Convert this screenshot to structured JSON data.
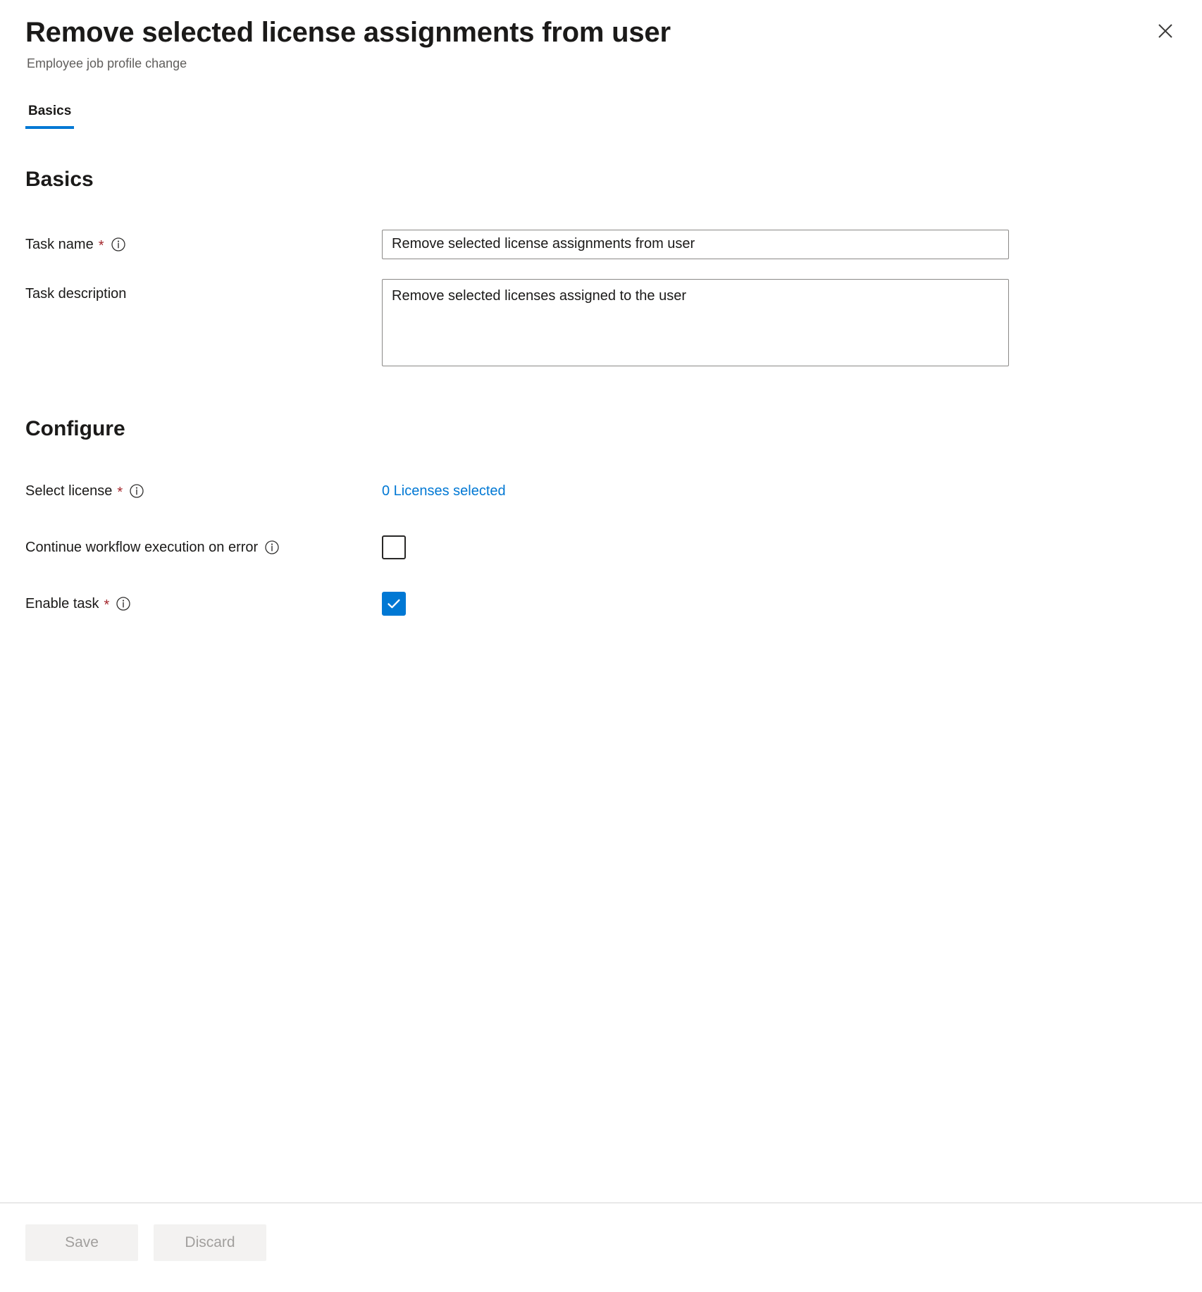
{
  "header": {
    "title": "Remove selected license assignments from user",
    "subtitle": "Employee job profile change",
    "close_label": "Close",
    "close_icon": "close-icon"
  },
  "tabs": [
    {
      "label": "Basics",
      "selected": true
    }
  ],
  "sections": {
    "basics": {
      "heading": "Basics",
      "task_name": {
        "label": "Task name",
        "required_marker": "*",
        "info_icon": "info-icon",
        "value": "Remove selected license assignments from user",
        "placeholder": ""
      },
      "task_description": {
        "label": "Task description",
        "value": "Remove selected licenses assigned to the user",
        "placeholder": ""
      }
    },
    "configure": {
      "heading": "Configure",
      "select_license": {
        "label": "Select license",
        "required_marker": "*",
        "info_icon": "info-icon",
        "link_text": "0 Licenses selected",
        "link_color": "#0078d4"
      },
      "continue_on_error": {
        "label": "Continue workflow execution on error",
        "info_icon": "info-icon",
        "checked": false
      },
      "enable_task": {
        "label": "Enable task",
        "required_marker": "*",
        "info_icon": "info-icon",
        "checked": true
      }
    }
  },
  "footer": {
    "save_label": "Save",
    "discard_label": "Discard"
  },
  "colors": {
    "accent": "#0078d4",
    "required": "#a4262c",
    "text": "#1b1a19",
    "subtle_text": "#605e5c",
    "border": "#8a8886",
    "disabled_button_bg": "#f3f2f1",
    "disabled_button_text": "#a19f9d"
  }
}
